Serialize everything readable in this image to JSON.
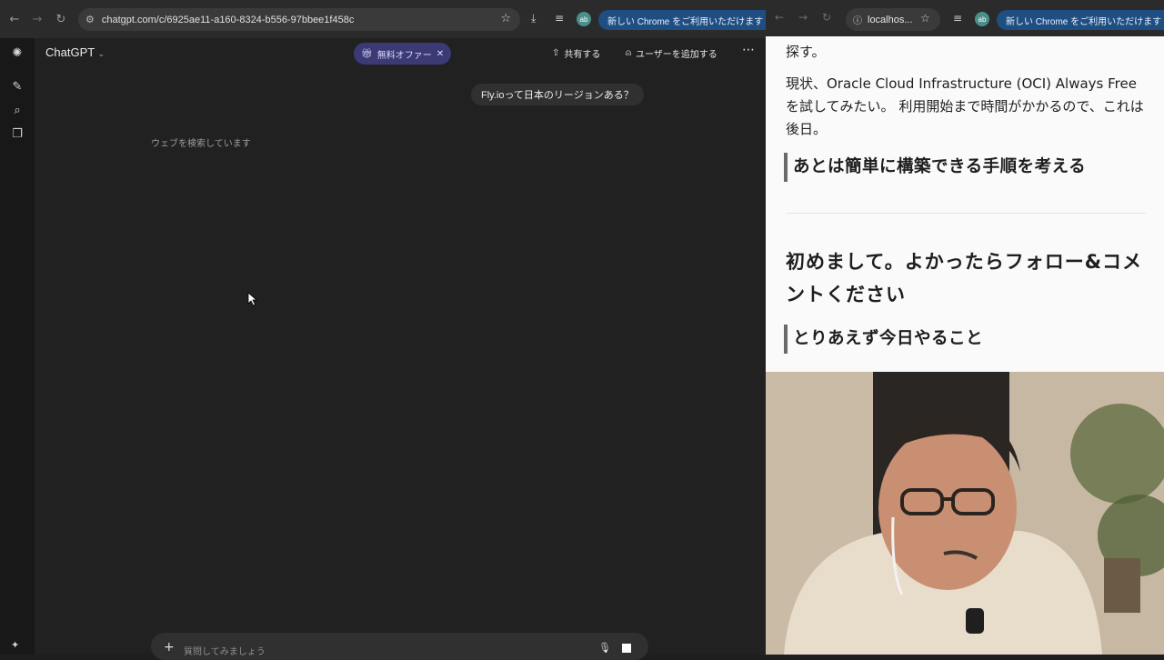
{
  "left_browser": {
    "url": "chatgpt.com/c/6925ae11-a160-8324-b556-97bbee1f458c",
    "profile_initials": "ab",
    "chrome_pill": "新しい Chrome をご利用いただけます"
  },
  "chatgpt": {
    "title": "ChatGPT",
    "offer_label": "無料オファー",
    "share_label": "共有する",
    "add_user_label": "ユーザーを追加する",
    "user_message": "Fly.ioって日本のリージョンある？",
    "status_text": "ウェブを検索しています",
    "composer_placeholder": "質問してみましょう"
  },
  "right_browser": {
    "url": "localhos...",
    "profile_initials": "ab",
    "chrome_pill": "新しい Chrome をご利用いただけます"
  },
  "blog": {
    "line1": "探す。",
    "paragraph": "現状、Oracle Cloud Infrastructure (OCI) Always Freeを試してみたい。 利用開始まで時間がかかるので、これは後日。",
    "heading1": "あとは簡単に構築できる手順を考える",
    "heading2": "初めまして。よかったらフォロー&コメントください",
    "heading3": "とりあえず今日やること"
  },
  "colors": {
    "chat_bg": "#212121",
    "offer_bg": "#3b3a75",
    "chrome_pill_bg": "#1f4f82"
  }
}
